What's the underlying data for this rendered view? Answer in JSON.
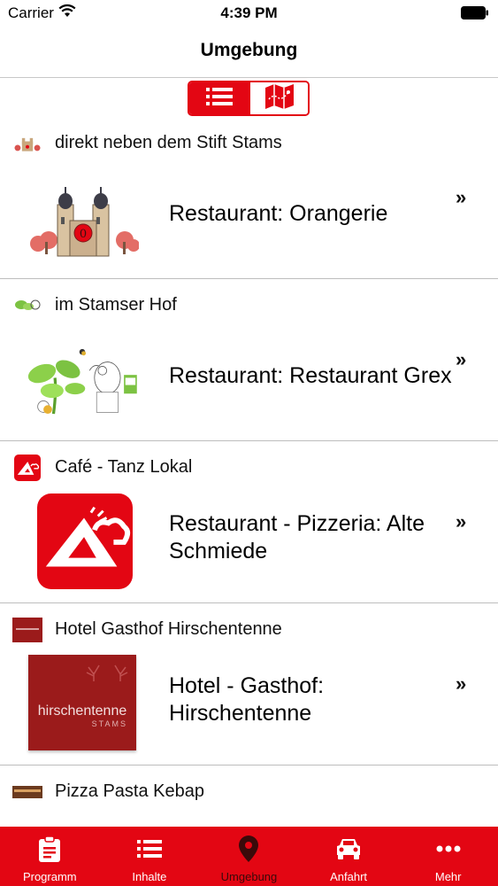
{
  "status_bar": {
    "carrier": "Carrier",
    "time": "4:39 PM"
  },
  "nav": {
    "title": "Umgebung"
  },
  "view_toggle": {
    "options": [
      "list-icon",
      "map-icon"
    ],
    "selected": "list"
  },
  "items": [
    {
      "subtitle": "direkt neben dem Stift Stams",
      "name": "Restaurant: Orangerie",
      "image": "stift-stams-illustration"
    },
    {
      "subtitle": "im Stamser Hof",
      "name": "Restaurant: Restaurant Grex",
      "image": "grex-illustration"
    },
    {
      "subtitle": "Café - Tanz Lokal",
      "name": "Restaurant - Pizzeria: Alte Schmiede",
      "image": "mountain-logo"
    },
    {
      "subtitle": "Hotel Gasthof Hirschentenne",
      "name": "Hotel - Gasthof: Hirschentenne",
      "image": "hirschentenne-logo",
      "logo_text": "hirschentenne",
      "logo_subtext": "STAMS"
    },
    {
      "subtitle": "Pizza Pasta Kebap"
    }
  ],
  "chevron": "»",
  "tabs": [
    {
      "label": "Programm",
      "icon": "clipboard-icon"
    },
    {
      "label": "Inhalte",
      "icon": "list-icon"
    },
    {
      "label": "Umgebung",
      "icon": "location-pin-icon",
      "active": true
    },
    {
      "label": "Anfahrt",
      "icon": "car-icon"
    },
    {
      "label": "Mehr",
      "icon": "more-icon"
    }
  ],
  "colors": {
    "accent": "#e30613",
    "active_tab_text": "#3a0a0a"
  }
}
